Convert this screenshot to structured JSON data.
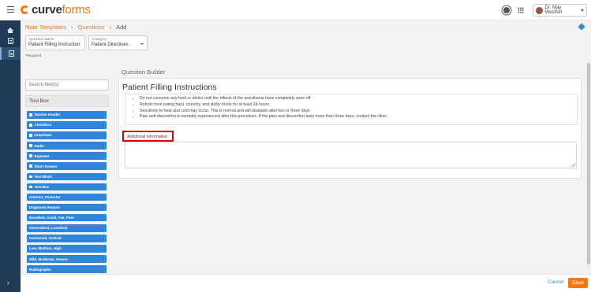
{
  "app": {
    "brand_prefix": "curve",
    "brand_suffix": "forms",
    "user_name": "Dr. May Westfall"
  },
  "breadcrumb": {
    "items": [
      "Note Templates",
      "Questions"
    ],
    "current": "Add"
  },
  "form": {
    "question_name_label": "Question Name",
    "question_name_value": "Patient Filling Instruction",
    "category_label": "Category",
    "category_value": "Patient Directives",
    "required_note": "*Required"
  },
  "left_panel": {
    "search_placeholder": "Search field(s)",
    "toolbox_title": "Tool Box",
    "tools": [
      "Section Header",
      "Checkbox",
      "Dropdown",
      "Radio",
      "Repeater",
      "Short Answer",
      "Text Block",
      "Text Box",
      "Anterior, Posterior",
      "Diagnosis Reason",
      "Excellent, Good, Fair, Poor",
      "Generalized, Localized",
      "Horizontal, Vertical",
      "Low, Medium, High",
      "Mild, Moderate, Severe",
      "Radiographs"
    ]
  },
  "builder": {
    "section_title": "Question Builder",
    "title": "Patient Filling Instructions",
    "instructions": [
      "Do not consume any food or drinks until the effects of the anesthesia have completely worn off.",
      "Refrain from eating hard, crunchy, and sticky foods for at least 24 hours.",
      "Sensitivity to heat and cold may occur. This is normal and will dissipate after two or three days.",
      "Pain and discomfort is normally experienced after this procedure. If the pain and discomfort lasts more than three days, contact the clinic."
    ],
    "additional_label": "Additional Information"
  },
  "footer": {
    "cancel_label": "Cancel",
    "save_label": "Save"
  },
  "colors": {
    "accent": "#f07a1a",
    "nav": "#1f3a57",
    "tool": "#2f86d8",
    "highlight": "#e00000"
  }
}
